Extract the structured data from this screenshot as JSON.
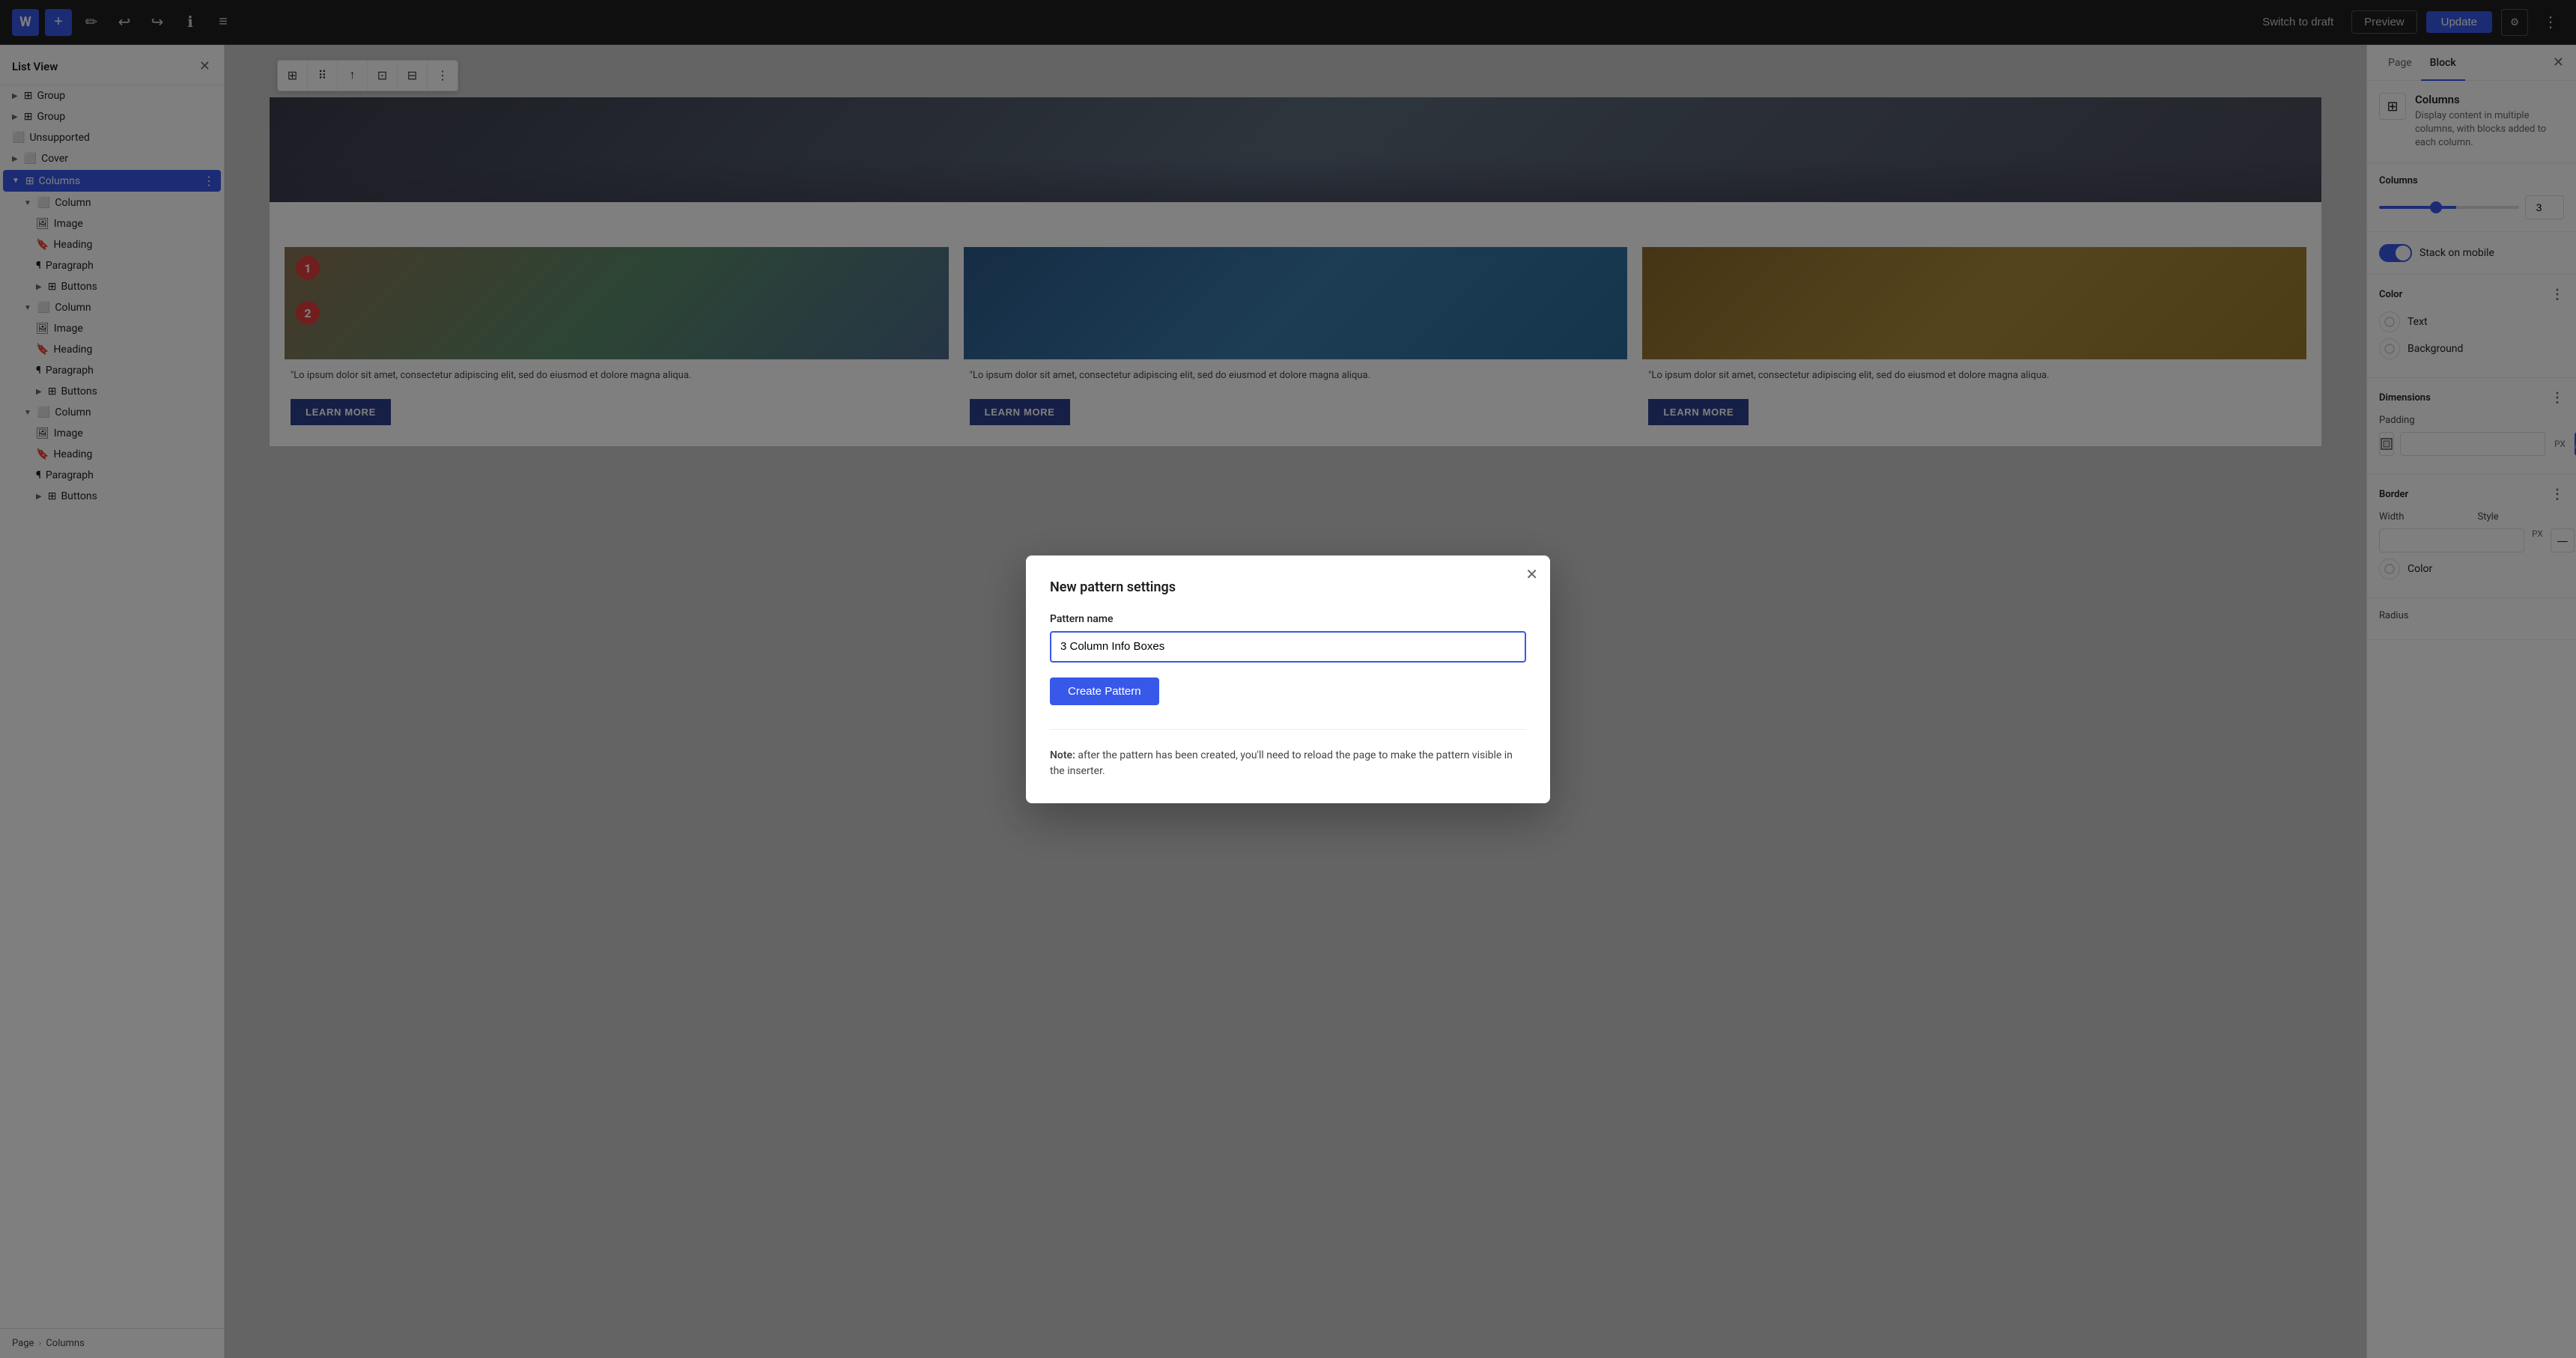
{
  "topbar": {
    "wp_logo": "W",
    "add_label": "+",
    "edit_label": "✏",
    "undo_label": "↩",
    "redo_label": "↪",
    "info_label": "ℹ",
    "list_view_label": "≡",
    "switch_to_draft_label": "Switch to draft",
    "preview_label": "Preview",
    "update_label": "Update",
    "gear_label": "⚙",
    "dots_label": "⋮"
  },
  "sidebar_left": {
    "title": "List View",
    "close_label": "✕",
    "items": [
      {
        "id": "group-1",
        "label": "Group",
        "indent": 0,
        "expandable": true,
        "expanded": false
      },
      {
        "id": "group-2",
        "label": "Group",
        "indent": 0,
        "expandable": true,
        "expanded": false
      },
      {
        "id": "unsupported",
        "label": "Unsupported",
        "indent": 0,
        "expandable": false
      },
      {
        "id": "cover",
        "label": "Cover",
        "indent": 0,
        "expandable": true,
        "expanded": false
      },
      {
        "id": "columns",
        "label": "Columns",
        "indent": 0,
        "expandable": true,
        "expanded": true,
        "selected": true
      },
      {
        "id": "column-1",
        "label": "Column",
        "indent": 1,
        "expandable": true,
        "expanded": true
      },
      {
        "id": "image-1",
        "label": "Image",
        "indent": 2
      },
      {
        "id": "heading-1",
        "label": "Heading",
        "indent": 2
      },
      {
        "id": "paragraph-1",
        "label": "Paragraph",
        "indent": 2
      },
      {
        "id": "buttons-1",
        "label": "Buttons",
        "indent": 2,
        "expandable": true
      },
      {
        "id": "column-2",
        "label": "Column",
        "indent": 1,
        "expandable": true,
        "expanded": true
      },
      {
        "id": "image-2",
        "label": "Image",
        "indent": 2
      },
      {
        "id": "heading-2",
        "label": "Heading",
        "indent": 2
      },
      {
        "id": "paragraph-2",
        "label": "Paragraph",
        "indent": 2
      },
      {
        "id": "buttons-2",
        "label": "Buttons",
        "indent": 2,
        "expandable": true
      },
      {
        "id": "column-3",
        "label": "Column",
        "indent": 1,
        "expandable": true,
        "expanded": true
      },
      {
        "id": "image-3",
        "label": "Image",
        "indent": 2
      },
      {
        "id": "heading-3",
        "label": "Heading",
        "indent": 2
      },
      {
        "id": "paragraph-3",
        "label": "Paragraph",
        "indent": 2
      },
      {
        "id": "buttons-3",
        "label": "Buttons",
        "indent": 2,
        "expandable": true
      }
    ]
  },
  "block_toolbar": {
    "columns_icon": "⊞",
    "drag_icon": "⠿",
    "move_icon": "↕",
    "align_icon": "⊡",
    "valign_icon": "⊟",
    "more_icon": "⋮"
  },
  "columns_content": {
    "col1": {
      "text": "\"Lo ipsum dolor sit amet, consectetur adipiscing elit, sed do eiusmod et dolore magna aliqua.",
      "btn_label": "LEARN MORE"
    },
    "col2": {
      "text": "\"Lo ipsum dolor sit amet, consectetur adipiscing elit, sed do eiusmod et dolore magna aliqua.",
      "btn_label": "LEARN MORE"
    },
    "col3": {
      "text": "\"Lo ipsum dolor sit amet, consectetur adipiscing elit, sed do eiusmod et dolore magna aliqua.",
      "btn_label": "LEARN MORE"
    }
  },
  "sidebar_right": {
    "page_tab": "Page",
    "block_tab": "Block",
    "close_label": "✕",
    "block_name": "Columns",
    "block_desc": "Display content in multiple columns, with blocks added to each column.",
    "columns_section": {
      "title": "Columns",
      "value": 3,
      "min": 1,
      "max": 6
    },
    "stack_on_mobile_label": "Stack on mobile",
    "color_section": {
      "title": "Color",
      "text_label": "Text",
      "background_label": "Background"
    },
    "dimensions_section": {
      "title": "Dimensions",
      "padding_label": "Padding",
      "unit": "PX"
    },
    "border_section": {
      "title": "Border",
      "width_label": "Width",
      "style_label": "Style",
      "color_label": "Color",
      "radius_label": "Radius",
      "unit": "PX"
    }
  },
  "modal": {
    "title": "New pattern settings",
    "close_label": "✕",
    "pattern_name_label": "Pattern name",
    "pattern_name_value": "3 Column Info Boxes",
    "create_btn_label": "Create Pattern",
    "note_text": "Note: after the pattern has been created, you'll need to reload the page to make the pattern visible in the inserter."
  },
  "breadcrumb": {
    "page_label": "Page",
    "separator": "›",
    "columns_label": "Columns"
  },
  "steps": {
    "step1": "1",
    "step2": "2"
  }
}
